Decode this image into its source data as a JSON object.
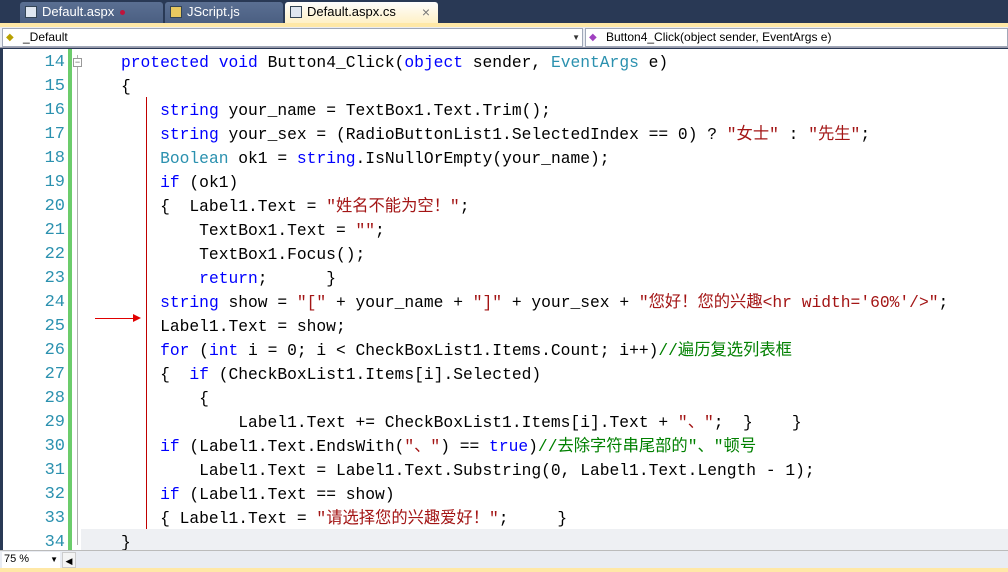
{
  "tabs": [
    {
      "label": "Default.aspx",
      "modified": true
    },
    {
      "label": "JScript.js"
    },
    {
      "label": "Default.aspx.cs",
      "active": true,
      "close": "×"
    }
  ],
  "nav": {
    "class_combo": "_Default",
    "member_combo": "Button4_Click(object sender, EventArgs e)"
  },
  "zoom": "75 %",
  "colors": {
    "keyword": "#0000ff",
    "type": "#2b91af",
    "string": "#a31515",
    "comment": "#008000"
  },
  "code": [
    {
      "n": "14",
      "tokens": [
        [
          "k",
          "protected"
        ],
        [
          "p",
          " "
        ],
        [
          "k",
          "void"
        ],
        [
          "p",
          " Button4_Click("
        ],
        [
          "k",
          "object"
        ],
        [
          "p",
          " sender, "
        ],
        [
          "t",
          "EventArgs"
        ],
        [
          "p",
          " e)"
        ]
      ]
    },
    {
      "n": "15",
      "tokens": [
        [
          "p",
          "{"
        ]
      ]
    },
    {
      "n": "16",
      "tokens": [
        [
          "p",
          "    "
        ],
        [
          "k",
          "string"
        ],
        [
          "p",
          " your_name = TextBox1.Text.Trim();"
        ]
      ]
    },
    {
      "n": "17",
      "tokens": [
        [
          "p",
          "    "
        ],
        [
          "k",
          "string"
        ],
        [
          "p",
          " your_sex = (RadioButtonList1.SelectedIndex == 0) ? "
        ],
        [
          "s",
          "\"女士\""
        ],
        [
          "p",
          " : "
        ],
        [
          "s",
          "\"先生\""
        ],
        [
          "p",
          ";"
        ]
      ]
    },
    {
      "n": "18",
      "tokens": [
        [
          "p",
          "    "
        ],
        [
          "t",
          "Boolean"
        ],
        [
          "p",
          " ok1 = "
        ],
        [
          "k",
          "string"
        ],
        [
          "p",
          ".IsNullOrEmpty(your_name);"
        ]
      ]
    },
    {
      "n": "19",
      "tokens": [
        [
          "p",
          "    "
        ],
        [
          "k",
          "if"
        ],
        [
          "p",
          " (ok1)"
        ]
      ]
    },
    {
      "n": "20",
      "tokens": [
        [
          "p",
          "    {  Label1.Text = "
        ],
        [
          "s",
          "\"姓名不能为空！\""
        ],
        [
          "p",
          ";"
        ]
      ]
    },
    {
      "n": "21",
      "tokens": [
        [
          "p",
          "        TextBox1.Text = "
        ],
        [
          "s",
          "\"\""
        ],
        [
          "p",
          ";"
        ]
      ]
    },
    {
      "n": "22",
      "tokens": [
        [
          "p",
          "        TextBox1.Focus();"
        ]
      ]
    },
    {
      "n": "23",
      "tokens": [
        [
          "p",
          "        "
        ],
        [
          "k",
          "return"
        ],
        [
          "p",
          ";      }"
        ]
      ]
    },
    {
      "n": "24",
      "tokens": [
        [
          "p",
          "    "
        ],
        [
          "k",
          "string"
        ],
        [
          "p",
          " show = "
        ],
        [
          "s",
          "\"[\""
        ],
        [
          "p",
          " + your_name + "
        ],
        [
          "s",
          "\"]\""
        ],
        [
          "p",
          " + your_sex + "
        ],
        [
          "s",
          "\"您好！您的兴趣<hr width='60%'/>\""
        ],
        [
          "p",
          ";"
        ]
      ]
    },
    {
      "n": "25",
      "tokens": [
        [
          "p",
          "    Label1.Text = show;"
        ]
      ]
    },
    {
      "n": "26",
      "tokens": [
        [
          "p",
          "    "
        ],
        [
          "k",
          "for"
        ],
        [
          "p",
          " ("
        ],
        [
          "k",
          "int"
        ],
        [
          "p",
          " i = 0; i < CheckBoxList1.Items.Count; i++)"
        ],
        [
          "c",
          "//遍历复选列表框"
        ]
      ]
    },
    {
      "n": "27",
      "tokens": [
        [
          "p",
          "    {  "
        ],
        [
          "k",
          "if"
        ],
        [
          "p",
          " (CheckBoxList1.Items[i].Selected)"
        ]
      ]
    },
    {
      "n": "28",
      "tokens": [
        [
          "p",
          "        {"
        ]
      ]
    },
    {
      "n": "29",
      "tokens": [
        [
          "p",
          "            Label1.Text += CheckBoxList1.Items[i].Text + "
        ],
        [
          "s",
          "\"、\""
        ],
        [
          "p",
          ";  }    }"
        ]
      ]
    },
    {
      "n": "30",
      "tokens": [
        [
          "p",
          "    "
        ],
        [
          "k",
          "if"
        ],
        [
          "p",
          " (Label1.Text.EndsWith("
        ],
        [
          "s",
          "\"、\""
        ],
        [
          "p",
          ") == "
        ],
        [
          "k",
          "true"
        ],
        [
          "p",
          ")"
        ],
        [
          "c",
          "//去除字符串尾部的\"、\"顿号"
        ]
      ]
    },
    {
      "n": "31",
      "tokens": [
        [
          "p",
          "        Label1.Text = Label1.Text.Substring(0, Label1.Text.Length - 1);"
        ]
      ]
    },
    {
      "n": "32",
      "tokens": [
        [
          "p",
          "    "
        ],
        [
          "k",
          "if"
        ],
        [
          "p",
          " (Label1.Text == show)"
        ]
      ]
    },
    {
      "n": "33",
      "tokens": [
        [
          "p",
          "    { Label1.Text = "
        ],
        [
          "s",
          "\"请选择您的兴趣爱好！\""
        ],
        [
          "p",
          ";     }"
        ]
      ]
    },
    {
      "n": "34",
      "tokens": [
        [
          "p",
          "}"
        ]
      ]
    }
  ]
}
